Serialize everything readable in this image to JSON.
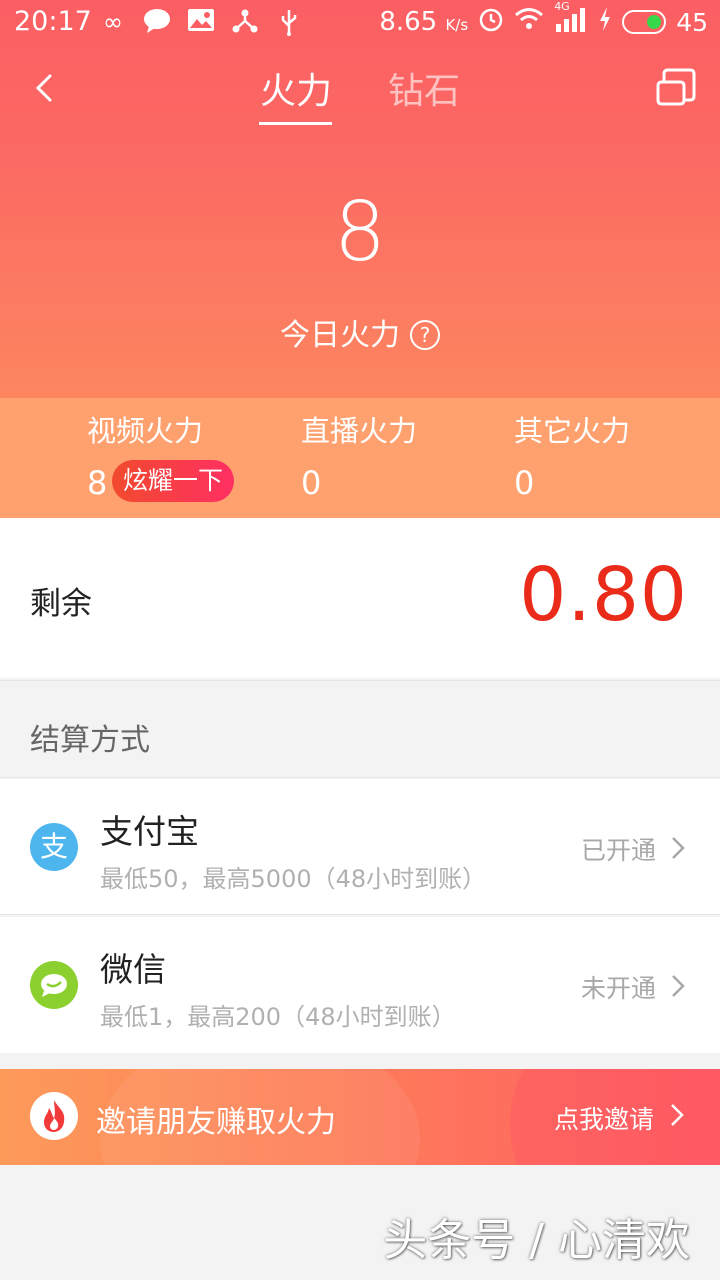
{
  "status_bar": {
    "time": "20:17",
    "speed": "8.65",
    "speed_unit": "K/s",
    "network": "4G",
    "battery": "45",
    "icons_left": [
      "infinity-icon",
      "chat-icon",
      "gallery-icon",
      "share-icon",
      "usb-icon"
    ]
  },
  "header": {
    "tabs": [
      {
        "label": "火力"
      },
      {
        "label": "钻石"
      }
    ],
    "active_tab": 0
  },
  "summary": {
    "today_value": "8",
    "today_label": "今日火力",
    "help_glyph": "?"
  },
  "stats": {
    "video": {
      "label": "视频火力",
      "value": "8",
      "badge": "炫耀一下"
    },
    "live": {
      "label": "直播火力",
      "value": "0"
    },
    "other": {
      "label": "其它火力",
      "value": "0"
    }
  },
  "balance": {
    "label": "剩余",
    "value": "0.80"
  },
  "settlement": {
    "title": "结算方式",
    "methods": [
      {
        "name": "支付宝",
        "desc": "最低50，最高5000（48小时到账）",
        "status": "已开通",
        "icon": "alipay-icon",
        "icon_glyph": "支"
      },
      {
        "name": "微信",
        "desc": "最低1，最高200（48小时到账）",
        "status": "未开通",
        "icon": "wechat-icon"
      }
    ]
  },
  "invite": {
    "text": "邀请朋友赚取火力",
    "button": "点我邀请"
  },
  "watermark": "头条号 / 心清欢",
  "colors": {
    "header_top": "#fb5e63",
    "stats_bg": "#ffa16f",
    "balance_red": "#ea2b1a",
    "alipay": "#4db6ee",
    "wechat": "#8cd02f"
  }
}
